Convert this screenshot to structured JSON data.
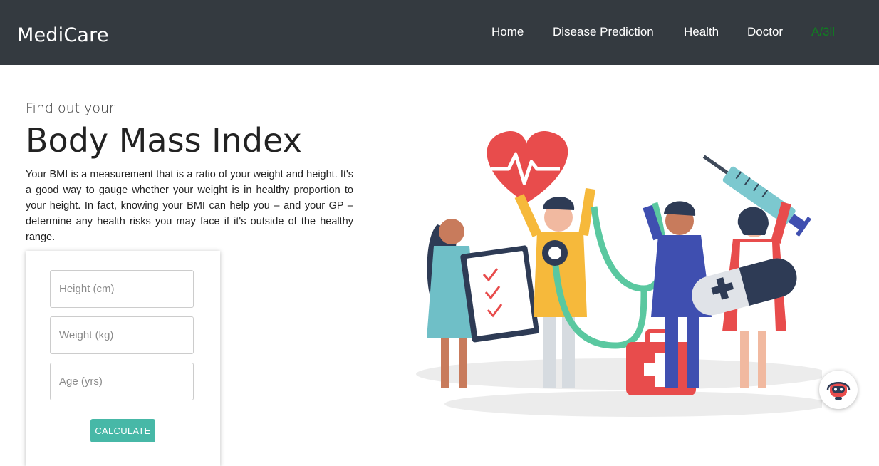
{
  "navbar": {
    "brand": "MediCare",
    "links": [
      "Home",
      "Disease Prediction",
      "Health",
      "Doctor",
      "A/3ll"
    ],
    "highlight_color": "#0f7f20",
    "background": "#343a40"
  },
  "hero": {
    "intro": "Find out your",
    "title": "Body Mass Index",
    "description": "Your BMI is a measurement that is a ratio of your weight and height. It's a good way to gauge whether your weight is in healthy proportion to your height. In fact, knowing your BMI can help you – and your GP – determine any health risks you may face if it's outside of the healthy range."
  },
  "form": {
    "height_placeholder": "Height (cm)",
    "weight_placeholder": "Weight (kg)",
    "age_placeholder": "Age (yrs)",
    "calculate_label": "CALCULATE",
    "button_color": "#47b8a7"
  },
  "icons": {
    "illustration": "medical-team-illustration",
    "chat": "chatbot-icon"
  }
}
